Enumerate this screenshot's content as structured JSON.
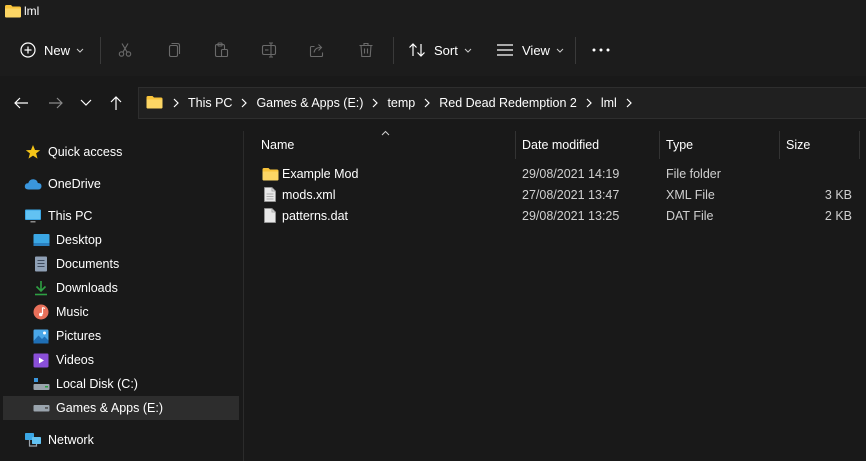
{
  "window": {
    "title": "lml"
  },
  "toolbar": {
    "new_label": "New",
    "sort_label": "Sort",
    "view_label": "View",
    "icons": [
      "plus-icon",
      "cut-icon",
      "copy-icon",
      "paste-icon",
      "rename-icon",
      "share-icon",
      "delete-icon",
      "sort-icon",
      "view-icon",
      "more-icon"
    ]
  },
  "address": {
    "breadcrumbs": [
      "This PC",
      "Games & Apps (E:)",
      "temp",
      "Red Dead Redemption 2",
      "lml"
    ]
  },
  "sidebar": {
    "items": [
      {
        "label": "Quick access",
        "icon": "star-icon"
      },
      {
        "label": "OneDrive",
        "icon": "cloud-icon"
      },
      {
        "label": "This PC",
        "icon": "monitor-icon"
      },
      {
        "label": "Desktop",
        "icon": "desktop-icon"
      },
      {
        "label": "Documents",
        "icon": "documents-icon"
      },
      {
        "label": "Downloads",
        "icon": "download-icon"
      },
      {
        "label": "Music",
        "icon": "music-icon"
      },
      {
        "label": "Pictures",
        "icon": "pictures-icon"
      },
      {
        "label": "Videos",
        "icon": "videos-icon"
      },
      {
        "label": "Local Disk (C:)",
        "icon": "disk-icon"
      },
      {
        "label": "Games & Apps (E:)",
        "icon": "drive-icon",
        "selected": true
      },
      {
        "label": "Network",
        "icon": "network-icon"
      }
    ]
  },
  "columns": {
    "name": "Name",
    "date": "Date modified",
    "type": "Type",
    "size": "Size"
  },
  "files": [
    {
      "name": "Example Mod",
      "date": "29/08/2021 14:19",
      "type": "File folder",
      "size": "",
      "icon": "folder-icon"
    },
    {
      "name": "mods.xml",
      "date": "27/08/2021 13:47",
      "type": "XML File",
      "size": "3 KB",
      "icon": "file-icon"
    },
    {
      "name": "patterns.dat",
      "date": "29/08/2021 13:25",
      "type": "DAT File",
      "size": "2 KB",
      "icon": "file-icon"
    }
  ],
  "colors": {
    "background": "#191919",
    "toolbar": "#1c1c1c",
    "selection": "#2d2d2d",
    "folder": "#f8c33a",
    "accent": "#4cc2ff"
  }
}
